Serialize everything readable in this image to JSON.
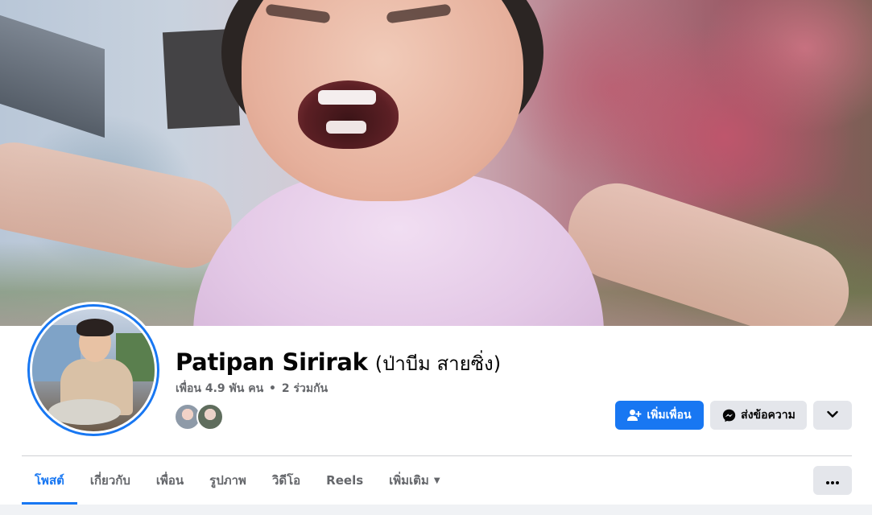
{
  "profile": {
    "name": "Patipan Sirirak",
    "alternate_name": "(ป่าบีม สายซิ่ง)",
    "friends_count": "เพื่อน 4.9 พัน คน",
    "separator": "•",
    "mutual_friends": "2 ร่วมกัน"
  },
  "actions": {
    "add_friend_label": "เพิ่มเพื่อน",
    "message_label": "ส่งข้อความ"
  },
  "tabs": [
    {
      "label": "โพสต์",
      "active": true
    },
    {
      "label": "เกี่ยวกับ",
      "active": false
    },
    {
      "label": "เพื่อน",
      "active": false
    },
    {
      "label": "รูปภาพ",
      "active": false
    },
    {
      "label": "วิดีโอ",
      "active": false
    },
    {
      "label": "Reels",
      "active": false
    },
    {
      "label": "เพิ่มเติม",
      "active": false
    }
  ],
  "colors": {
    "accent": "#1877f2",
    "secondary_button": "#e4e6eb",
    "muted_text": "#65676b"
  },
  "icons": {
    "add_friend": "person-plus-icon",
    "message": "messenger-icon",
    "dropdown": "chevron-down-icon",
    "more_tab": "caret-down-icon",
    "options": "ellipsis-icon"
  }
}
